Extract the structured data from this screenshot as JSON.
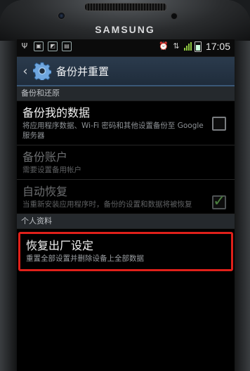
{
  "device": {
    "brand": "SAMSUNG"
  },
  "status_bar": {
    "time": "17:05"
  },
  "title_bar": {
    "back_icon": "chevron-left-icon",
    "settings_icon": "gear-icon",
    "title": "备份并重置"
  },
  "sections": [
    {
      "header": "备份和还原",
      "items": [
        {
          "label": "备份我的数据",
          "summary": "将应用程序数据、Wi-Fi 密码和其他设置备份至 Google 服务器",
          "checkbox": true,
          "checked": false,
          "enabled": true
        },
        {
          "label": "备份账户",
          "summary": "需要设置备用帐户",
          "checkbox": false,
          "enabled": false
        },
        {
          "label": "自动恢复",
          "summary": "当重新安装应用程序时，备份的设置和数据将被恢复",
          "checkbox": true,
          "checked": true,
          "enabled": false
        }
      ]
    },
    {
      "header": "个人资料",
      "items": [
        {
          "label": "恢复出厂设定",
          "summary": "重置全部设置并删除设备上全部数据",
          "highlighted": true,
          "highlight_color": "#e0201a"
        }
      ]
    }
  ],
  "colors": {
    "accent": "#3a5878",
    "highlight": "#e0201a",
    "check": "#4a7f3e"
  }
}
